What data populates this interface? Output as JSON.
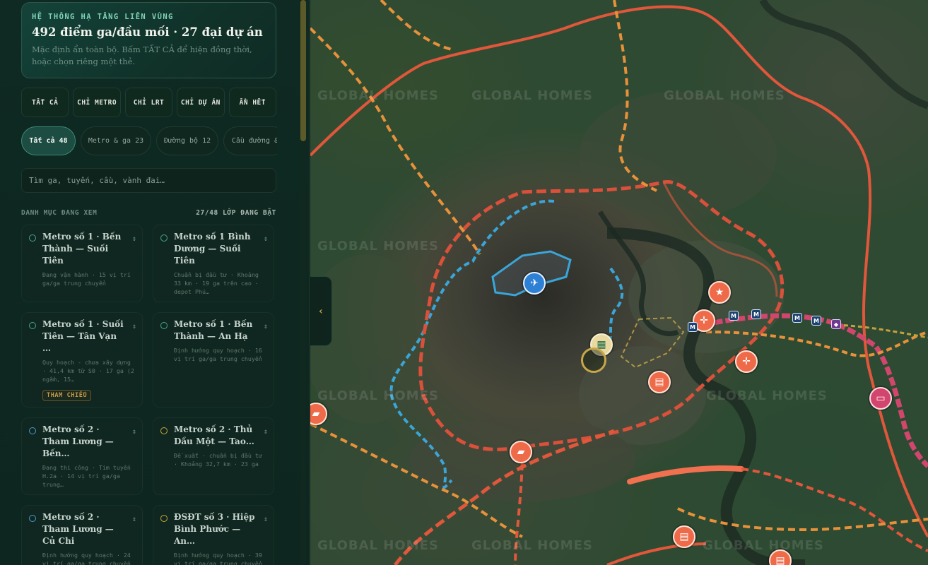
{
  "panel": {
    "kicker": "HỆ THỐNG HẠ TẦNG LIÊN VÙNG",
    "title": "492 điểm ga/đầu mối · 27 đại dự án",
    "description": "Mặc định ẩn toàn bộ. Bấm TẤT CẢ để hiện đồng thời, hoặc chọn riêng một thẻ."
  },
  "filters": [
    "TẤT CẢ",
    "CHỈ METRO",
    "CHỈ LRT",
    "CHỈ DỰ ÁN",
    "ẨN HẾT"
  ],
  "pills": [
    {
      "label": "Tất cả 48",
      "active": true
    },
    {
      "label": "Metro & ga 23",
      "active": false
    },
    {
      "label": "Đường bộ 12",
      "active": false
    },
    {
      "label": "Cầu đường &",
      "active": false
    }
  ],
  "search": {
    "placeholder": "Tìm ga, tuyến, cầu, vành đai…"
  },
  "section": {
    "title": "DANH MỤC ĐANG XEM",
    "count": "27/48 LỚP ĐANG BẬT"
  },
  "routes": [
    {
      "name": "Metro số 1 · Bến Thành — Suối Tiên",
      "meta": "Đang vận hành · 15 vị trí ga/ga trung chuyển",
      "dot": "green",
      "tag": ""
    },
    {
      "name": "Metro số 1 Bình Dương — Suối Tiên",
      "meta": "Chuẩn bị đầu tư · Khoảng 33 km · 19 ga trên cao · depot Phú…",
      "dot": "green",
      "tag": ""
    },
    {
      "name": "Metro số 1 · Suối Tiên — Tân Vạn …",
      "meta": "Quy hoạch - chưa xây dựng · 41,4 km từ S0 · 17 ga (2 ngầm, 15…",
      "dot": "green",
      "tag": "THAM CHIẾU"
    },
    {
      "name": "Metro số 1 · Bến Thành — An Hạ",
      "meta": "Định hướng quy hoạch · 16 vị trí ga/ga trung chuyển",
      "dot": "green",
      "tag": ""
    },
    {
      "name": "Metro số 2 · Tham Lương — Bến…",
      "meta": "Đang thi công · Tim tuyến H.2a · 14 vị trí ga/ga trung…",
      "dot": "blue",
      "tag": ""
    },
    {
      "name": "Metro số 2 · Thủ Dầu Một — Tao…",
      "meta": "Đề xuất · chuẩn bị đầu tư · Khoảng 32,7 km · 23 ga",
      "dot": "yellow",
      "tag": ""
    },
    {
      "name": "Metro số 2 · Tham Lương — Củ Chi",
      "meta": "Định hướng quy hoạch · 24 vị trí ga/ga trung chuyển",
      "dot": "blue",
      "tag": ""
    },
    {
      "name": "ĐSĐT số 3 · Hiệp Bình Phước — An…",
      "meta": "Định hướng quy hoạch · 39 vị trí ga/ga trung chuyển",
      "dot": "yellow",
      "tag": ""
    }
  ],
  "map": {
    "watermark": "GLOBAL HOMES",
    "marker_icons": {
      "airport": "airplane-icon",
      "star": "star-icon",
      "junction": "crosshair-icon",
      "ticket": "ticket-icon",
      "train": "train-icon",
      "building": "building-icon",
      "bus": "bus-icon",
      "metro": "metro-station-icon",
      "diamond": "diamond-icon"
    },
    "metro_badge": "M",
    "colors": {
      "ring_road": "#e0573b",
      "expressway": "#e7913a",
      "metro": "#d2466e",
      "district_outline": "#3aa5d8"
    }
  },
  "collapse_handle": "‹"
}
